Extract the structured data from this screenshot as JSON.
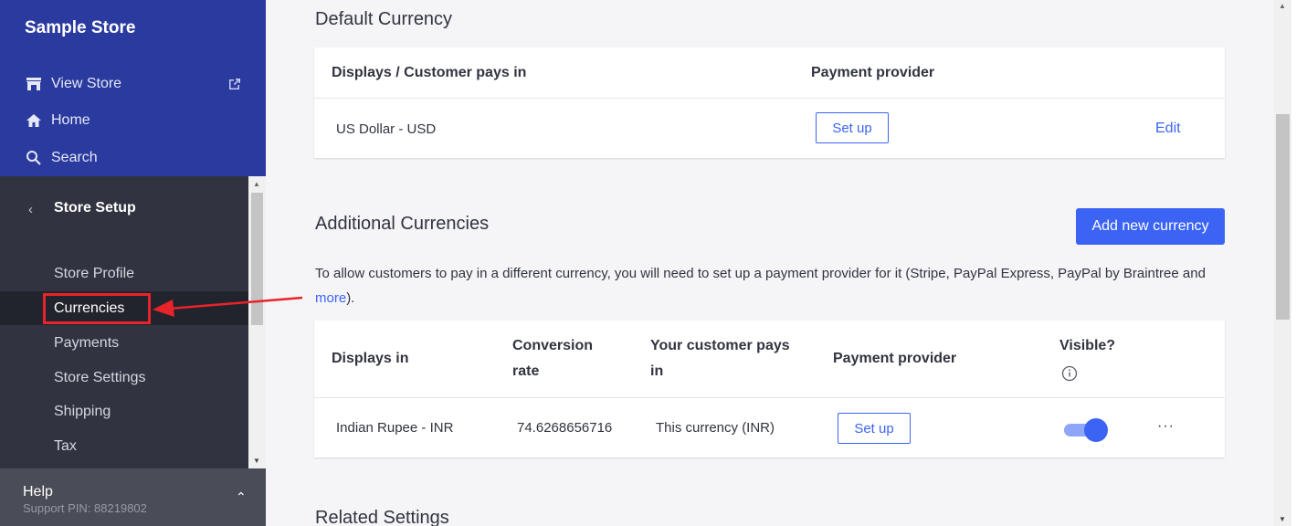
{
  "sidebar": {
    "store_name": "Sample Store",
    "top_links": [
      {
        "label": "View Store",
        "icon": "storefront-icon"
      },
      {
        "label": "Home",
        "icon": "home-icon"
      },
      {
        "label": "Search",
        "icon": "search-icon"
      }
    ],
    "section_title": "Store Setup",
    "nav_items": [
      "Store Profile",
      "Currencies",
      "Payments",
      "Store Settings",
      "Shipping",
      "Tax"
    ],
    "active_item": "Currencies",
    "help": {
      "title": "Help",
      "pin": "Support PIN: 88219802"
    }
  },
  "default_currency": {
    "title": "Default Currency",
    "headers": {
      "displays": "Displays / Customer pays in",
      "provider": "Payment provider"
    },
    "row": {
      "currency": "US Dollar - USD",
      "setup_label": "Set up",
      "edit_label": "Edit"
    }
  },
  "additional_currencies": {
    "title": "Additional Currencies",
    "add_button": "Add new currency",
    "description_prefix": "To allow customers to pay in a different currency, you will need to set up a payment provider for it (Stripe, PayPal Express, PayPal by Braintree and ",
    "description_link": "more",
    "description_suffix": ").",
    "headers": {
      "displays_in": "Displays in",
      "conversion_rate_1": "Conversion",
      "conversion_rate_2": "rate",
      "customer_pays_1": "Your customer pays",
      "customer_pays_2": "in",
      "provider": "Payment provider",
      "visible": "Visible?"
    },
    "rows": [
      {
        "displays_in": "Indian Rupee - INR",
        "rate": "74.6268656716",
        "pays_in": "This currency (INR)",
        "setup_label": "Set up",
        "visible": true,
        "more": "···"
      }
    ]
  },
  "related_settings": {
    "title": "Related Settings"
  },
  "colors": {
    "accent": "#3c64f4",
    "sidebar_top": "#2a3a9e",
    "sidebar": "#313440",
    "highlight": "#e8232a"
  }
}
